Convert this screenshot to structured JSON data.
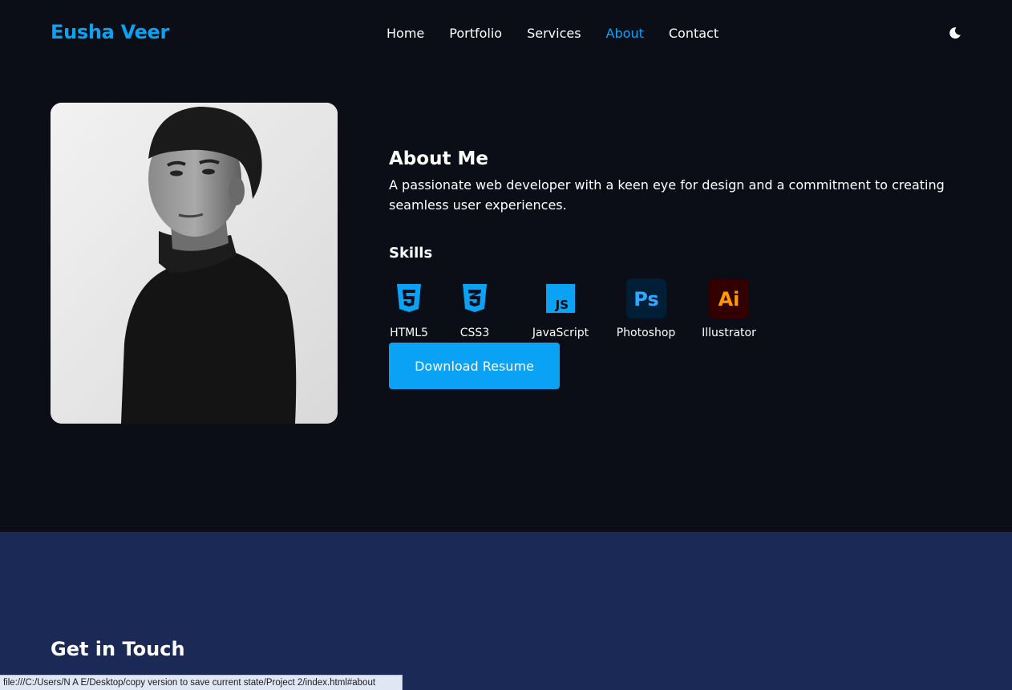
{
  "brand": {
    "name": "Eusha Veer",
    "color": "#0aa2f5"
  },
  "nav": {
    "links": [
      {
        "label": "Home",
        "active": false
      },
      {
        "label": "Portfolio",
        "active": false
      },
      {
        "label": "Services",
        "active": false
      },
      {
        "label": "About",
        "active": true
      },
      {
        "label": "Contact",
        "active": false
      }
    ],
    "theme_toggle_icon": "moon-icon"
  },
  "about": {
    "title": "About Me",
    "description": "A passionate web developer with a keen eye for design and a commitment to creating seamless user experiences.",
    "skills_title": "Skills",
    "skills": [
      {
        "label": "HTML5",
        "icon": "html5-icon"
      },
      {
        "label": "CSS3",
        "icon": "css3-icon"
      },
      {
        "label": "JavaScript",
        "icon": "javascript-icon"
      },
      {
        "label": "Photoshop",
        "icon": "photoshop-icon"
      },
      {
        "label": "Illustrator",
        "icon": "illustrator-icon"
      }
    ],
    "download_button": "Download Resume"
  },
  "contact": {
    "title": "Get in Touch"
  },
  "status_bar": {
    "url": "file:///C:/Users/N A E/Desktop/copy version to save current state/Project 2/index.html#about"
  },
  "colors": {
    "accent": "#0aa2f5",
    "page_bg": "#0b0e16",
    "contact_bg": "#1b2956"
  }
}
